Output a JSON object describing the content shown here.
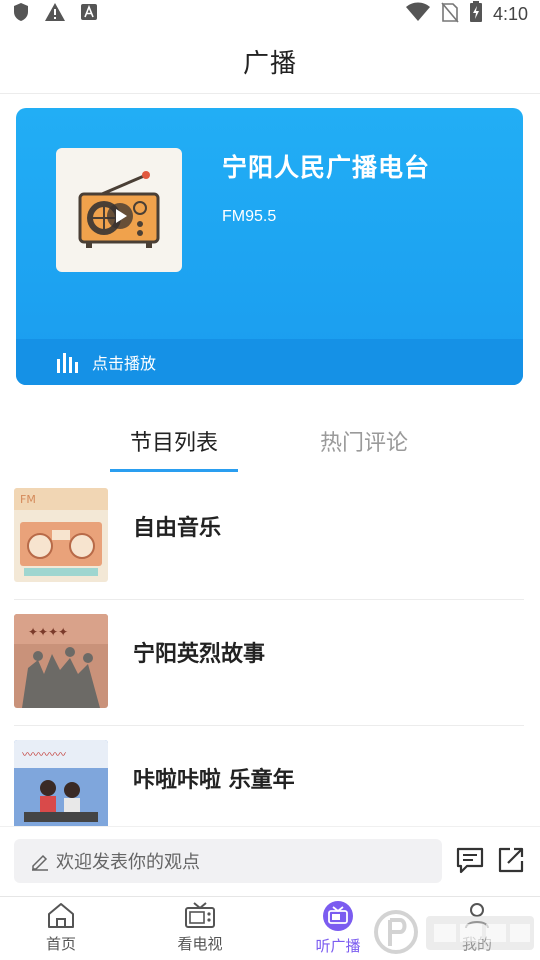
{
  "status_bar": {
    "time": "4:10"
  },
  "header": {
    "title": "广播"
  },
  "station": {
    "name": "宁阳人民广播电台",
    "frequency": "FM95.5",
    "play_label": "点击播放",
    "card_color": "#1fa8f2"
  },
  "tabs": [
    {
      "label": "节目列表",
      "active": true
    },
    {
      "label": "热门评论",
      "active": false
    }
  ],
  "programs": [
    {
      "title": "自由音乐"
    },
    {
      "title": "宁阳英烈故事"
    },
    {
      "title": "咔啦咔啦 乐童年"
    }
  ],
  "comment": {
    "placeholder": "欢迎发表你的观点"
  },
  "bottom_nav": [
    {
      "label": "首页",
      "icon": "home-icon"
    },
    {
      "label": "看电视",
      "icon": "tv-icon"
    },
    {
      "label": "听广播",
      "icon": "radio-icon",
      "active": true
    },
    {
      "label": "我的",
      "icon": "profile-icon"
    }
  ],
  "accent_color": "#2a9ef0",
  "nav_active_color": "#7b5cf0"
}
